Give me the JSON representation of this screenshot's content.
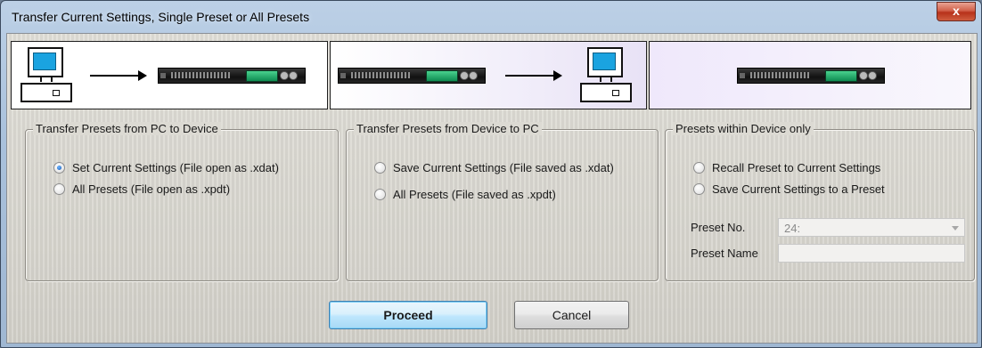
{
  "window": {
    "title": "Transfer Current Settings, Single Preset or All Presets",
    "close_label": "x"
  },
  "groups": {
    "pc_to_device": {
      "legend": "Transfer Presets from PC to Device",
      "options": [
        {
          "label": "Set Current Settings (File open as .xdat)",
          "checked": true
        },
        {
          "label": "All Presets (File open as .xpdt)",
          "checked": false
        }
      ]
    },
    "device_to_pc": {
      "legend": "Transfer Presets from  Device to PC",
      "options": [
        {
          "label": "Save Current Settings (File saved as .xdat)",
          "checked": false
        },
        {
          "label": "All Presets (File saved as .xpdt)",
          "checked": false
        }
      ]
    },
    "device_only": {
      "legend": "Presets within Device only",
      "options": [
        {
          "label": "Recall Preset to Current Settings",
          "checked": false
        },
        {
          "label": "Save Current Settings to a Preset",
          "checked": false
        }
      ],
      "preset_no_label": "Preset No.",
      "preset_no_value": "24:",
      "preset_name_label": "Preset Name",
      "preset_name_value": ""
    }
  },
  "buttons": {
    "proceed": "Proceed",
    "cancel": "Cancel"
  },
  "icons": [
    "computer-icon",
    "arrow-right-icon",
    "device-rack-icon",
    "close-icon",
    "chevron-down-icon"
  ],
  "colors": {
    "title_bar": "#a9c1dc",
    "close_button": "#c8452b",
    "proceed_border": "#3c7fb1",
    "device_display": "#2bb573"
  }
}
